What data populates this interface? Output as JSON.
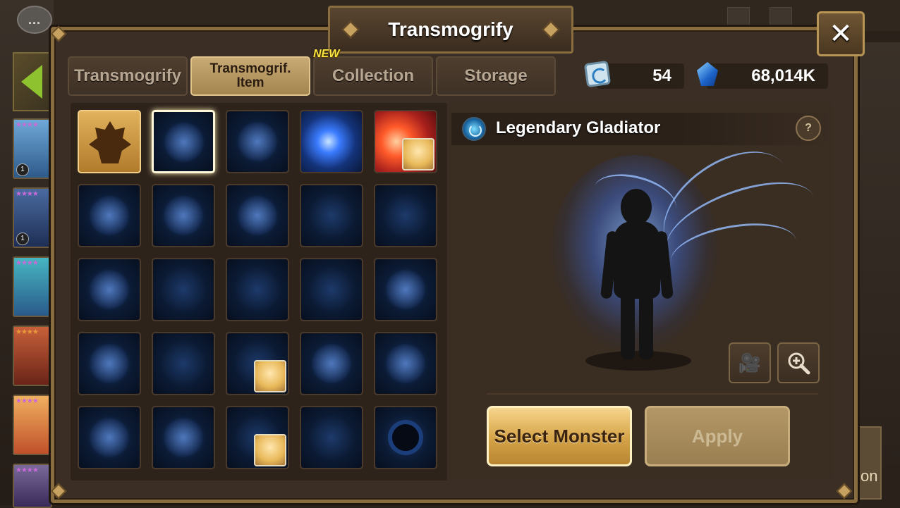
{
  "background": {
    "chat_icon": "chat-bubble-icon",
    "chat_text": "...",
    "right_partial_text": "on",
    "monster_levels": [
      "1",
      "1"
    ]
  },
  "modal": {
    "title": "Transmogrify",
    "close_icon": "close-icon",
    "close_symbol": "✕"
  },
  "tabs": [
    {
      "label": "Transmogrify"
    },
    {
      "label": "Transmogrif.\nItem",
      "active": true
    },
    {
      "label": "Collection",
      "badge": "NEW"
    },
    {
      "label": "Storage"
    }
  ],
  "currencies": [
    {
      "icon": "transmog-stone-icon",
      "value": "54"
    },
    {
      "icon": "crystal-icon",
      "value": "68,014K"
    }
  ],
  "grid": {
    "columns": 5,
    "rows": 5,
    "items": [
      {
        "style": "gold",
        "icon": "gladiator-crown-icon"
      },
      {
        "style": "wings",
        "selected": true
      },
      {
        "style": "wings"
      },
      {
        "style": "lightning"
      },
      {
        "style": "fire",
        "has_monster": true
      },
      {
        "style": "aura"
      },
      {
        "style": "aura"
      },
      {
        "style": "aura"
      },
      {
        "style": "aura"
      },
      {
        "style": "aura"
      },
      {
        "style": "aura"
      },
      {
        "style": "hearts"
      },
      {
        "style": "bubbles"
      },
      {
        "style": "stars"
      },
      {
        "style": "sparkle"
      },
      {
        "style": "swirl"
      },
      {
        "style": "rain"
      },
      {
        "style": "wand",
        "has_monster": true
      },
      {
        "style": "aura"
      },
      {
        "style": "aura"
      },
      {
        "style": "vortex"
      },
      {
        "style": "glow"
      },
      {
        "style": "staff",
        "has_monster": true
      },
      {
        "style": "aura"
      },
      {
        "style": "ring"
      }
    ]
  },
  "preview": {
    "name": "Legendary Gladiator",
    "name_icon": "rune-swirl-icon",
    "info_symbol": "?",
    "video_icon": "video-camera-icon",
    "zoom_icon": "zoom-in-icon",
    "select_button": "Select Monster",
    "apply_button": "Apply"
  },
  "colors": {
    "accent_gold": "#d5a347",
    "frame": "#8a6d3f",
    "panel": "#3b2e24"
  }
}
